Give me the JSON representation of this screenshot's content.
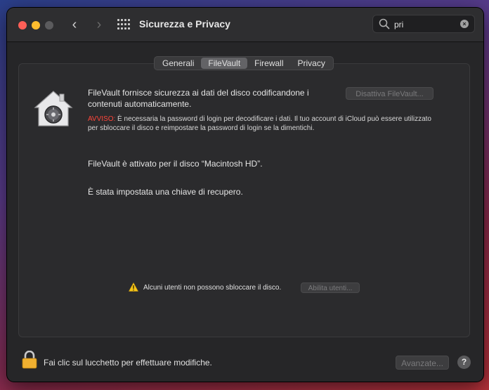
{
  "window": {
    "title": "Sicurezza e Privacy",
    "nav_back": "‹",
    "nav_forward": "›"
  },
  "search": {
    "value": "pri",
    "clear_glyph": "×"
  },
  "tabs": [
    {
      "label": "Generali",
      "active": false
    },
    {
      "label": "FileVault",
      "active": true
    },
    {
      "label": "Firewall",
      "active": false
    },
    {
      "label": "Privacy",
      "active": false
    }
  ],
  "filevault": {
    "description": "FileVault fornisce sicurezza ai dati del disco codificandone i contenuti automaticamente.",
    "disable_button": "Disattiva FileVault...",
    "warning_label": "AVVISO:",
    "warning_text": " È necessaria la password di login per decodificare i dati. Il tuo account di iCloud può essere utilizzato per sbloccare il disco e reimpostare la password di login se la dimentichi.",
    "status_enabled": "FileVault è attivato per il disco “Macintosh HD”.",
    "status_recovery": "È stata impostata una chiave di recupero.",
    "users_alert": "Alcuni utenti non possono sbloccare il disco.",
    "enable_users_button": "Abilita utenti..."
  },
  "footer": {
    "lock_text": "Fai clic sul lucchetto per effettuare modifiche.",
    "advanced_button": "Avanzate...",
    "help_glyph": "?"
  },
  "colors": {
    "warning_red": "#ff453a",
    "lock_gold": "#f0b030",
    "alert_yellow": "#f5c518"
  },
  "icons": {
    "house": "filevault-house-icon",
    "lock": "lock-icon",
    "alert": "warning-icon",
    "search": "search-icon"
  }
}
